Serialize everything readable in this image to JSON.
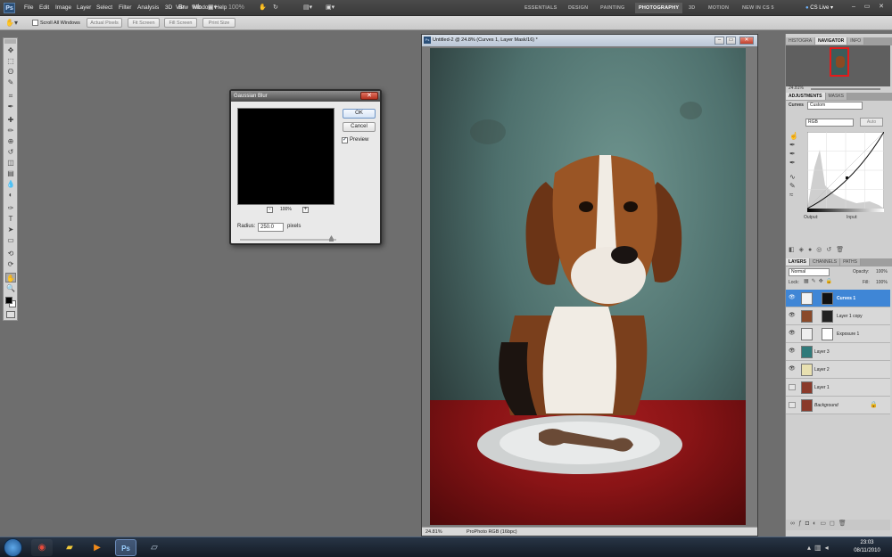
{
  "app": {
    "logo": "Ps",
    "menus": [
      "File",
      "Edit",
      "Image",
      "Layer",
      "Select",
      "Filter",
      "Analysis",
      "3D",
      "View",
      "Window",
      "Help"
    ],
    "zoom_field": "100%",
    "workspaces": [
      "ESSENTIALS",
      "DESIGN",
      "PAINTING",
      "PHOTOGRAPHY",
      "3D",
      "MOTION",
      "NEW IN CS 5"
    ],
    "active_workspace": "PHOTOGRAPHY",
    "cs_live": "CS Live",
    "window_buttons": [
      "–",
      "▭",
      "✕"
    ]
  },
  "options_bar": {
    "scroll_all_windows": "Scroll All Windows",
    "buttons": [
      "Actual Pixels",
      "Fit Screen",
      "Fill Screen",
      "Print Size"
    ]
  },
  "toolbox": {
    "tools": [
      "move-icon",
      "marquee-icon",
      "lasso-icon",
      "quick-select-icon",
      "crop-icon",
      "eyedropper-icon",
      "healing-icon",
      "brush-icon",
      "clone-stamp-icon",
      "history-brush-icon",
      "eraser-icon",
      "gradient-icon",
      "blur-icon",
      "dodge-icon",
      "pen-icon",
      "type-icon",
      "path-select-icon",
      "rectangle-icon",
      "3d-rotate-icon",
      "3d-orbit-icon",
      "hand-icon",
      "zoom-icon"
    ],
    "glyphs": [
      "✥",
      "⬚",
      "ʘ",
      "✎",
      "⌗",
      "✒",
      "✚",
      "✏",
      "⊕",
      "↺",
      "◫",
      "▤",
      "💧",
      "◐",
      "✑",
      "T",
      "➤",
      "▭",
      "⟲",
      "⟳",
      "✋",
      "🔍"
    ],
    "selected_index": 20,
    "foreground": "#000000",
    "background": "#ffffff"
  },
  "document": {
    "title": "Untitled-2 @ 24.8% (Curves 1, Layer Mask/16) *",
    "zoom": "24.81%",
    "profile": "ProPhoto RGB (16bpc)"
  },
  "dialog": {
    "title": "Gaussian Blur",
    "ok": "OK",
    "cancel": "Cancel",
    "preview_label": "Preview",
    "preview_checked": true,
    "zoom": "100%",
    "zoom_minus": "-",
    "zoom_plus": "+",
    "radius_label": "Radius:",
    "radius_value": "250.0",
    "radius_unit": "pixels",
    "close": "✕"
  },
  "panels": {
    "navigator_tabs": [
      "HISTOGRA",
      "NAVIGATOR",
      "INFO"
    ],
    "navigator_zoom": "24.81%",
    "adjust_tabs": [
      "ADJUSTMENTS",
      "MASKS"
    ],
    "curves_label": "Curves",
    "preset": "Custom",
    "channel": "RGB",
    "auto": "Auto",
    "output_label": "Output:",
    "input_label": "Input:",
    "layers_tabs": [
      "LAYERS",
      "CHANNELS",
      "PATHS"
    ],
    "blend_mode": "Normal",
    "opacity_label": "Opacity:",
    "opacity": "100%",
    "lock_label": "Lock:",
    "fill_label": "Fill:",
    "fill": "100%",
    "layers": [
      {
        "name": "Curves 1",
        "selected": true,
        "visible": true,
        "thumb": "#f2f2f2",
        "mask": "#111"
      },
      {
        "name": "Layer 1 copy",
        "selected": false,
        "visible": true,
        "thumb": "#8a4a2a",
        "mask": "#222"
      },
      {
        "name": "Exposure 1",
        "selected": false,
        "visible": true,
        "thumb": "#eee",
        "mask": "#fff"
      },
      {
        "name": "Layer 3",
        "selected": false,
        "visible": true,
        "thumb": "#2f7a7a",
        "mask": ""
      },
      {
        "name": "Layer 2",
        "selected": false,
        "visible": true,
        "thumb": "#e8e0b0",
        "mask": ""
      },
      {
        "name": "Layer 1",
        "selected": false,
        "visible": false,
        "thumb": "#8a3a2a",
        "mask": ""
      },
      {
        "name": "Background",
        "selected": false,
        "visible": false,
        "thumb": "#8a3a2a",
        "mask": ""
      }
    ]
  },
  "taskbar": {
    "time": "23:03",
    "date": "08/11/2010"
  }
}
